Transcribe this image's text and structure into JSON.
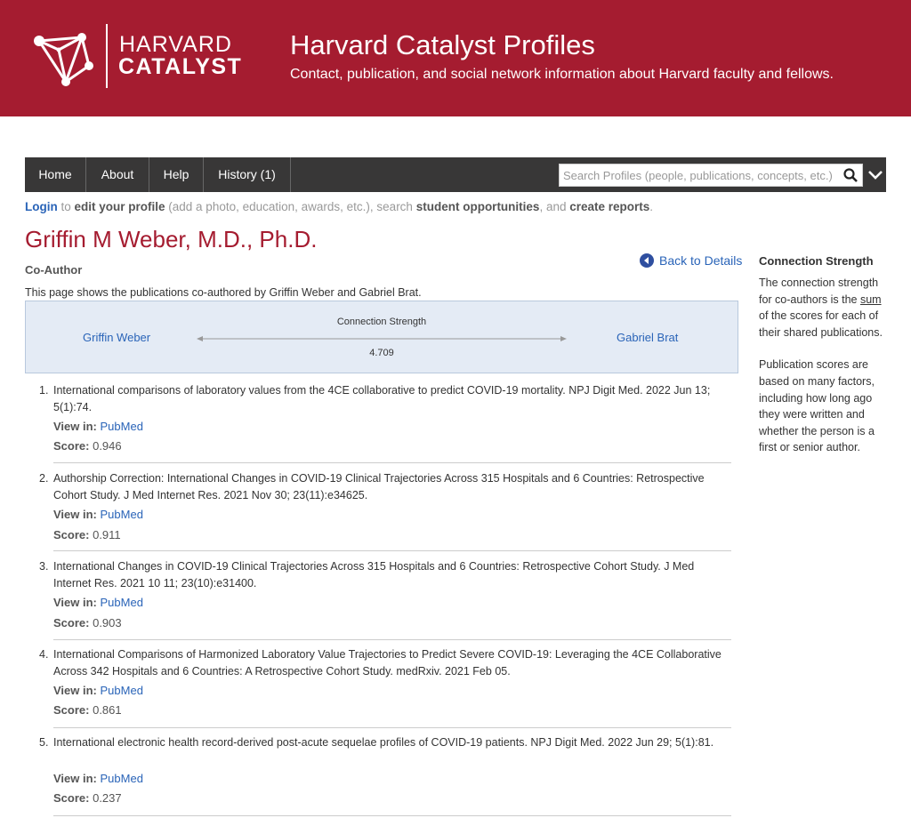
{
  "header": {
    "logo_line1": "HARVARD",
    "logo_line2": "CATALYST",
    "title": "Harvard Catalyst Profiles",
    "tagline": "Contact, publication, and social network information about Harvard faculty and fellows.",
    "brand_color": "#a51c30"
  },
  "nav": {
    "items": [
      {
        "label": "Home"
      },
      {
        "label": "About"
      },
      {
        "label": "Help"
      },
      {
        "label": "History (1)"
      }
    ],
    "search_placeholder": "Search Profiles (people, publications, concepts, etc.)",
    "search_icon": "search-icon",
    "menu_icon": "chevron-down-icon"
  },
  "loginbar": {
    "login": "Login",
    "t1": " to ",
    "edit": "edit your profile",
    "t2": " (add a photo, education, awards, etc.), search ",
    "student": "student opportunities",
    "t3": ", and ",
    "reports": "create reports",
    "t4": "."
  },
  "profile": {
    "name": "Griffin M Weber, M.D., Ph.D.",
    "subtitle": "Co-Author",
    "back_label": "Back to Details",
    "description": "This page shows the publications co-authored by Griffin Weber and Gabriel Brat."
  },
  "connection": {
    "person1": "Griffin Weber",
    "person2": "Gabriel Brat",
    "label": "Connection Strength",
    "value": "4.709"
  },
  "publications": [
    {
      "num": "1.",
      "title": "International comparisons of laboratory values from the 4CE collaborative to predict COVID-19 mortality. NPJ Digit Med. 2022 Jun 13; 5(1):74.",
      "view_label": "View in:",
      "link": "PubMed",
      "score_label": "Score:",
      "score": "0.946"
    },
    {
      "num": "2.",
      "title": "Authorship Correction: International Changes in COVID-19 Clinical Trajectories Across 315 Hospitals and 6 Countries: Retrospective Cohort Study. J Med Internet Res. 2021 Nov 30; 23(11):e34625.",
      "view_label": "View in:",
      "link": "PubMed",
      "score_label": "Score:",
      "score": "0.911"
    },
    {
      "num": "3.",
      "title": "International Changes in COVID-19 Clinical Trajectories Across 315 Hospitals and 6 Countries: Retrospective Cohort Study. J Med Internet Res. 2021 10 11; 23(10):e31400.",
      "view_label": "View in:",
      "link": "PubMed",
      "score_label": "Score:",
      "score": "0.903"
    },
    {
      "num": "4.",
      "title": "International Comparisons of Harmonized Laboratory Value Trajectories to Predict Severe COVID-19: Leveraging the 4CE Collaborative Across 342 Hospitals and 6 Countries: A Retrospective Cohort Study. medRxiv. 2021 Feb 05.",
      "view_label": "View in:",
      "link": "PubMed",
      "score_label": "Score:",
      "score": "0.861"
    },
    {
      "num": "5.",
      "title": "International electronic health record-derived post-acute sequelae profiles of COVID-19 patients. NPJ Digit Med. 2022 Jun 29; 5(1):81.",
      "view_label": "View in:",
      "link": "PubMed",
      "score_label": "Score:",
      "score": "0.237"
    }
  ],
  "sidebar": {
    "title": "Connection Strength",
    "p1_a": "The connection strength for co-authors is the ",
    "p1_u": "sum",
    "p1_b": " of the scores for each of their shared publications.",
    "p2": "Publication scores are based on many factors, including how long ago they were written and whether the person is a first or senior author."
  }
}
